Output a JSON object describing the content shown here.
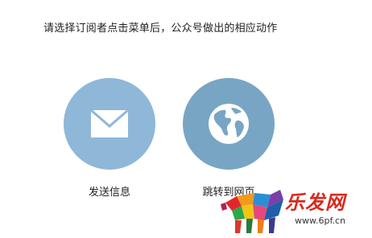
{
  "instruction": "请选择订阅者点击菜单后，公众号做出的相应动作",
  "options": [
    {
      "label": "发送信息",
      "icon": "envelope-icon",
      "color": "#8fb7d8"
    },
    {
      "label": "跳转到网页",
      "icon": "globe-icon",
      "color": "#78a5c4"
    }
  ],
  "watermark": {
    "brand": "乐发网",
    "url": "www.6pf.cn"
  }
}
